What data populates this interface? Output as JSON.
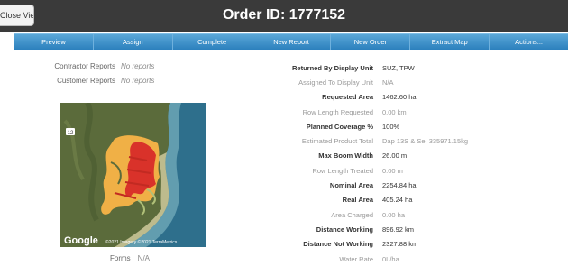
{
  "header": {
    "close_view_label": "Close View",
    "title": "Order ID: 1777152"
  },
  "toolbar": [
    "Preview",
    "Assign",
    "Complete",
    "New Report",
    "New Order",
    "Extract Map",
    "Actions..."
  ],
  "left": {
    "contractor_reports": {
      "label": "Contractor Reports",
      "value": "No reports"
    },
    "customer_reports": {
      "label": "Customer Reports",
      "value": "No reports"
    },
    "forms": {
      "label": "Forms",
      "value": "N/A"
    }
  },
  "map": {
    "road_marker": "12",
    "attribution_logo": "Google",
    "attribution_text": "©2021 Imagery ©2021 TerraMetrics"
  },
  "details": [
    {
      "label": "Returned By Display Unit",
      "value": "SUZ, TPW",
      "bold": true
    },
    {
      "label": "Assigned To Display Unit",
      "value": "N/A",
      "bold": false
    },
    {
      "label": "Requested Area",
      "value": "1462.60 ha",
      "bold": true
    },
    {
      "label": "Row Length Requested",
      "value": "0.00 km",
      "bold": false
    },
    {
      "label": "Planned Coverage %",
      "value": "100%",
      "bold": true
    },
    {
      "label": "Estimated Product Total",
      "value": "Dap 13S & Se: 335971.15kg",
      "bold": false
    },
    {
      "label": "Max Boom Width",
      "value": "26.00 m",
      "bold": true
    },
    {
      "label": "Row Length Treated",
      "value": "0.00 m",
      "bold": false
    },
    {
      "label": "Nominal Area",
      "value": "2254.84 ha",
      "bold": true
    },
    {
      "label": "Real Area",
      "value": "405.24 ha",
      "bold": true
    },
    {
      "label": "Area Charged",
      "value": "0.00 ha",
      "bold": false
    },
    {
      "label": "Distance Working",
      "value": "896.92 km",
      "bold": true
    },
    {
      "label": "Distance Not Working",
      "value": "2327.88 km",
      "bold": true
    },
    {
      "label": "Water Rate",
      "value": "0L/ha",
      "bold": false
    }
  ]
}
